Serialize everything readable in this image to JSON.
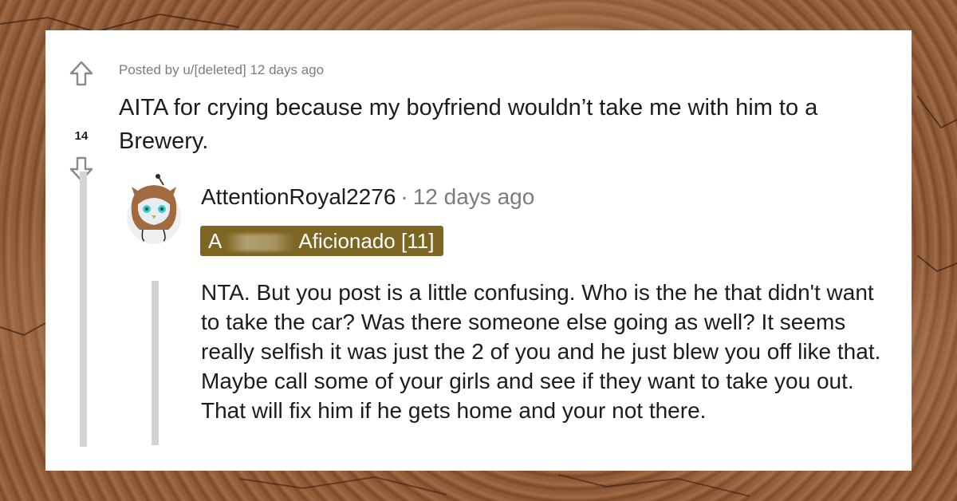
{
  "post": {
    "posted_by": "Posted by u/[deleted] 12 days ago",
    "vote_count": "14",
    "title": "AITA for crying because my boyfriend wouldn’t take me with him to a Brewery."
  },
  "comment": {
    "author": "AttentionRoyal2276",
    "separator": "·",
    "time": "12 days ago",
    "flair_start": "A",
    "flair_end": "Aficionado [11]",
    "body": "NTA. But you post is a little confusing. Who is the he that didn't want to take the car? Was there someone else going as well? It seems really selfish it was just the 2 of you and he just blew you off like that. Maybe call some of your girls and see if they want to take you out. That will fix him if he gets home and your not there."
  },
  "colors": {
    "flair_bg": "#7d6522",
    "text": "#1c1c1c",
    "muted": "#7c7c7c",
    "thread_line": "#d3d3d3"
  },
  "icons": [
    "upvote-arrow-icon",
    "downvote-arrow-icon",
    "snoo-owl-avatar-icon"
  ]
}
